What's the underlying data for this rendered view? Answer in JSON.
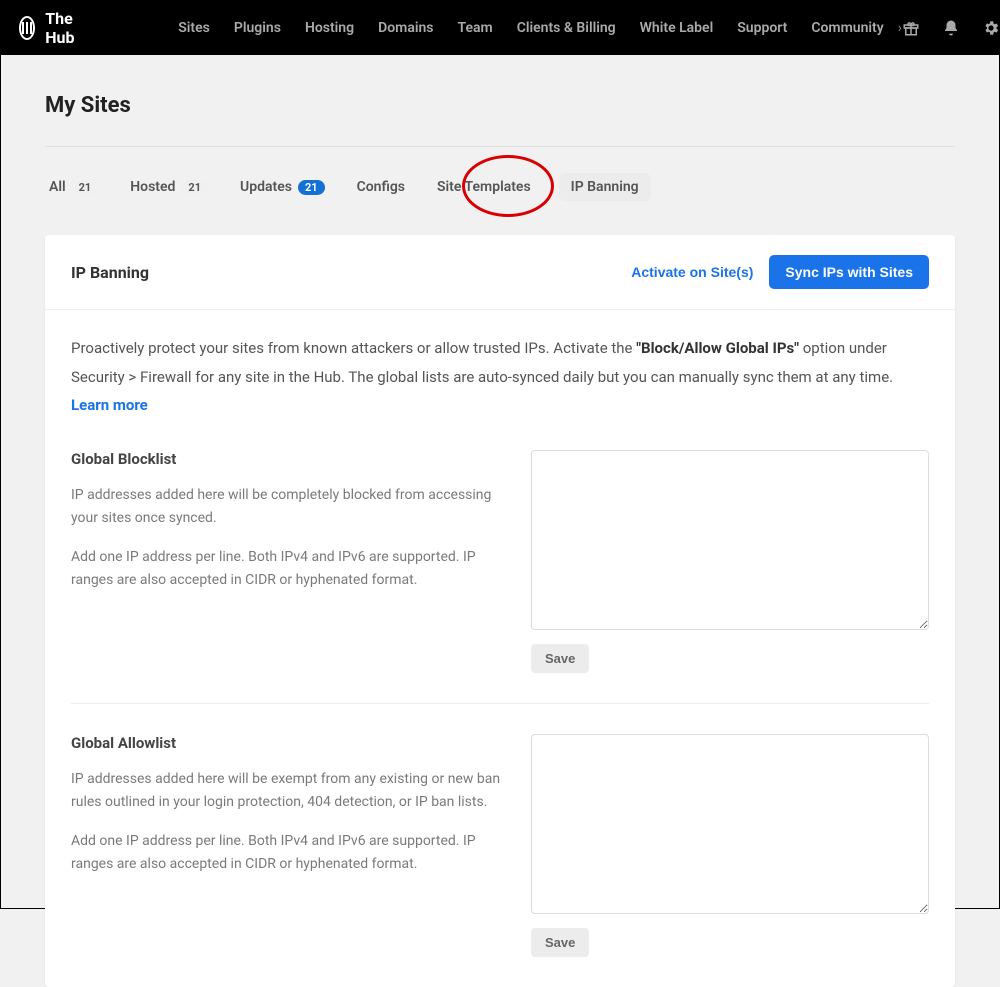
{
  "brand": "The Hub",
  "nav": {
    "items": [
      "Sites",
      "Plugins",
      "Hosting",
      "Domains",
      "Team",
      "Clients & Billing",
      "White Label",
      "Support",
      "Community"
    ]
  },
  "page": {
    "title": "My Sites"
  },
  "tabs": {
    "all": {
      "label": "All",
      "count": "21"
    },
    "hosted": {
      "label": "Hosted",
      "count": "21"
    },
    "updates": {
      "label": "Updates",
      "count": "21"
    },
    "configs": {
      "label": "Configs"
    },
    "templates": {
      "label": "Site Templates"
    },
    "ipban": {
      "label": "IP Banning"
    }
  },
  "card": {
    "title": "IP Banning",
    "activate": "Activate on Site(s)",
    "sync": "Sync IPs with Sites",
    "intro_pre": "Proactively protect your sites from known attackers or allow trusted IPs. Activate the ",
    "intro_bold": "\"Block/Allow Global IPs\"",
    "intro_post": " option under Security > Firewall for any site in the Hub. The global lists are auto-synced daily but you can manually sync them at any time. ",
    "learn": "Learn more"
  },
  "block": {
    "title": "Global Blocklist",
    "p1": "IP addresses added here will be completely blocked from accessing your sites once synced.",
    "p2": "Add one IP address per line. Both IPv4 and IPv6 are supported. IP ranges are also accepted in CIDR or hyphenated format.",
    "value": "",
    "save": "Save"
  },
  "allow": {
    "title": "Global Allowlist",
    "p1": "IP addresses added here will be exempt from any existing or new ban rules outlined in your login protection, 404 detection, or IP ban lists.",
    "p2": "Add one IP address per line. Both IPv4 and IPv6 are supported. IP ranges are also accepted in CIDR or hyphenated format.",
    "value": "",
    "save": "Save"
  }
}
